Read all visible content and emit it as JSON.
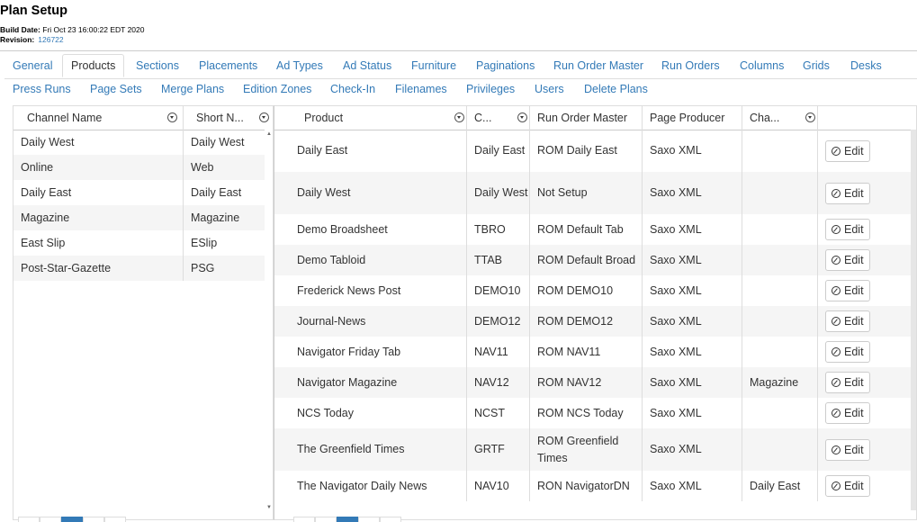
{
  "header": {
    "title": "Plan Setup",
    "build_label": "Build Date:",
    "build_value": "Fri Oct 23 16:00:22 EDT 2020",
    "revision_label": "Revision:",
    "revision_value": "126722"
  },
  "tabs_row1": [
    "General",
    "Products",
    "Sections",
    "Placements",
    "Ad Types",
    "Ad Status",
    "Furniture",
    "Paginations",
    "Run Order Master",
    "Run Orders",
    "Columns",
    "Grids",
    "Desks"
  ],
  "tabs_row2": [
    "Press Runs",
    "Page Sets",
    "Merge Plans",
    "Edition Zones",
    "Check-In",
    "Filenames",
    "Privileges",
    "Users",
    "Delete Plans"
  ],
  "active_tab": "Products",
  "channels": {
    "columns": [
      "Channel Name",
      "Short N..."
    ],
    "rows": [
      [
        "Daily West",
        "Daily West"
      ],
      [
        "Online",
        "Web"
      ],
      [
        "Daily East",
        "Daily East"
      ],
      [
        "Magazine",
        "Magazine"
      ],
      [
        "East Slip",
        "ESlip"
      ],
      [
        "Post-Star-Gazette",
        "PSG"
      ]
    ]
  },
  "products": {
    "columns": [
      "Product",
      "C...",
      "Run Order Master",
      "Page Producer",
      "Cha..."
    ],
    "edit_label": "Edit",
    "rows": [
      [
        "Daily East",
        "Daily East",
        "ROM Daily East",
        "Saxo XML",
        ""
      ],
      [
        "Daily West",
        "Daily West",
        "Not Setup",
        "Saxo XML",
        ""
      ],
      [
        "Demo Broadsheet",
        "TBRO",
        "ROM Default Tab",
        "Saxo XML",
        ""
      ],
      [
        "Demo Tabloid",
        "TTAB",
        "ROM Default Broad",
        "Saxo XML",
        ""
      ],
      [
        "Frederick News Post",
        "DEMO10",
        "ROM DEMO10",
        "Saxo XML",
        ""
      ],
      [
        "Journal-News",
        "DEMO12",
        "ROM DEMO12",
        "Saxo XML",
        ""
      ],
      [
        "Navigator Friday Tab",
        "NAV11",
        "ROM NAV11",
        "Saxo XML",
        ""
      ],
      [
        "Navigator Magazine",
        "NAV12",
        "ROM NAV12",
        "Saxo XML",
        "Magazine"
      ],
      [
        "NCS Today",
        "NCST",
        "ROM NCS Today",
        "Saxo XML",
        ""
      ],
      [
        "The Greenfield Times",
        "GRTF",
        "ROM Greenfield Times",
        "Saxo XML",
        ""
      ],
      [
        "The Navigator Daily News",
        "NAV10",
        "RON NavigatorDN",
        "Saxo XML",
        "Daily East"
      ]
    ]
  }
}
